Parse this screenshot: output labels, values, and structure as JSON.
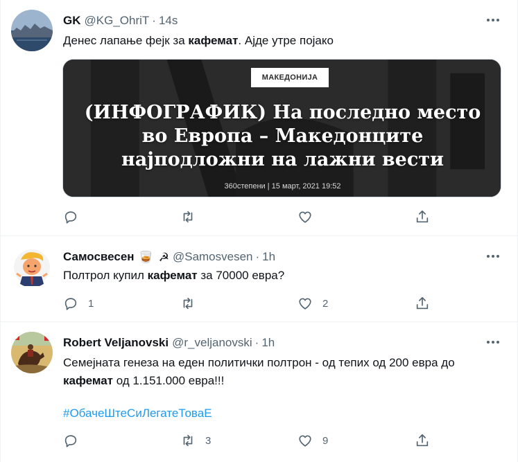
{
  "tweets": [
    {
      "name": "GK",
      "handle": "@KG_OhriT",
      "time": "14s",
      "text_before": "Денес лапање фејк за ",
      "text_bold": "кафемат",
      "text_after": ". Ајде утре појако",
      "card": {
        "tag": "МАКЕДОНИЈА",
        "title": "(ИНФОГРАФИК) На последно место во Европа – Македонците најподложни на лажни вести",
        "meta": "360степени | 15 март, 2021 19:52"
      },
      "actions": {
        "reply": "",
        "retweet": "",
        "like": ""
      }
    },
    {
      "name": "Самосвесен",
      "emoji1": "🥃",
      "emoji2": "☭",
      "handle": "@Samosvesen",
      "time": "1h",
      "text_before": "Полтрол купил ",
      "text_bold": "кафемат",
      "text_after": " за 70000 евра?",
      "actions": {
        "reply": "1",
        "retweet": "",
        "like": "2"
      }
    },
    {
      "name": "Robert Veljanovski",
      "handle": "@r_veljanovski",
      "time": "1h",
      "line1": "Семејната генеза на еден политички полтрон - од тепих од 200 евра до",
      "line2_bold": "кафемат",
      "line2_after": " од 1.151.000 евра!!!",
      "hashtag": "#ОбачеШтеСиЛегатеТоваЕ",
      "actions": {
        "reply": "",
        "retweet": "3",
        "like": "9"
      }
    }
  ],
  "colors": {
    "text": "#0f1419",
    "secondary": "#536471",
    "link": "#1d9bf0",
    "border": "#eff3f4"
  },
  "icons": [
    "more-icon",
    "reply-icon",
    "retweet-icon",
    "like-icon",
    "share-icon"
  ]
}
